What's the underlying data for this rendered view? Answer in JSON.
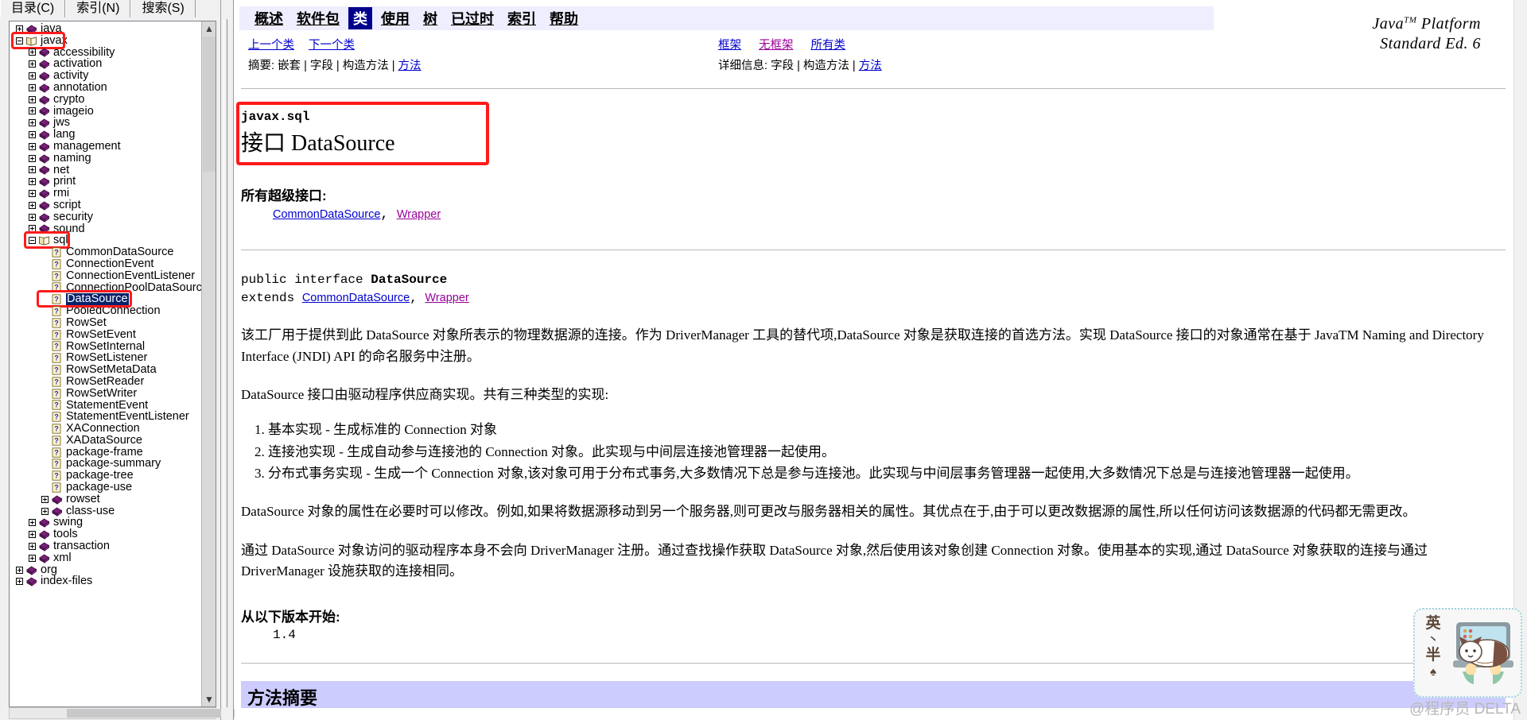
{
  "left_pane": {
    "tabs": [
      {
        "label": "目录(C)",
        "active": true
      },
      {
        "label": "索引(N)",
        "active": false
      },
      {
        "label": "搜索(S)",
        "active": false
      }
    ],
    "tree": [
      {
        "label": "java",
        "depth": 0,
        "icon": "package-icon",
        "expander": "plus",
        "selected": false
      },
      {
        "label": "javax",
        "depth": 0,
        "icon": "openbook-icon",
        "expander": "minus",
        "selected": false,
        "highlight": true
      },
      {
        "label": "accessibility",
        "depth": 1,
        "icon": "package-icon",
        "expander": "plus",
        "selected": false
      },
      {
        "label": "activation",
        "depth": 1,
        "icon": "package-icon",
        "expander": "plus",
        "selected": false
      },
      {
        "label": "activity",
        "depth": 1,
        "icon": "package-icon",
        "expander": "plus",
        "selected": false
      },
      {
        "label": "annotation",
        "depth": 1,
        "icon": "package-icon",
        "expander": "plus",
        "selected": false
      },
      {
        "label": "crypto",
        "depth": 1,
        "icon": "package-icon",
        "expander": "plus",
        "selected": false
      },
      {
        "label": "imageio",
        "depth": 1,
        "icon": "package-icon",
        "expander": "plus",
        "selected": false
      },
      {
        "label": "jws",
        "depth": 1,
        "icon": "package-icon",
        "expander": "plus",
        "selected": false
      },
      {
        "label": "lang",
        "depth": 1,
        "icon": "package-icon",
        "expander": "plus",
        "selected": false
      },
      {
        "label": "management",
        "depth": 1,
        "icon": "package-icon",
        "expander": "plus",
        "selected": false
      },
      {
        "label": "naming",
        "depth": 1,
        "icon": "package-icon",
        "expander": "plus",
        "selected": false
      },
      {
        "label": "net",
        "depth": 1,
        "icon": "package-icon",
        "expander": "plus",
        "selected": false
      },
      {
        "label": "print",
        "depth": 1,
        "icon": "package-icon",
        "expander": "plus",
        "selected": false
      },
      {
        "label": "rmi",
        "depth": 1,
        "icon": "package-icon",
        "expander": "plus",
        "selected": false
      },
      {
        "label": "script",
        "depth": 1,
        "icon": "package-icon",
        "expander": "plus",
        "selected": false
      },
      {
        "label": "security",
        "depth": 1,
        "icon": "package-icon",
        "expander": "plus",
        "selected": false
      },
      {
        "label": "sound",
        "depth": 1,
        "icon": "package-icon",
        "expander": "plus",
        "selected": false
      },
      {
        "label": "sql",
        "depth": 1,
        "icon": "openbook-icon",
        "expander": "minus",
        "selected": false,
        "highlight": true
      },
      {
        "label": "CommonDataSource",
        "depth": 2,
        "icon": "page-icon",
        "expander": "none",
        "selected": false
      },
      {
        "label": "ConnectionEvent",
        "depth": 2,
        "icon": "page-icon",
        "expander": "none",
        "selected": false
      },
      {
        "label": "ConnectionEventListener",
        "depth": 2,
        "icon": "page-icon",
        "expander": "none",
        "selected": false
      },
      {
        "label": "ConnectionPoolDataSource",
        "depth": 2,
        "icon": "page-icon",
        "expander": "none",
        "selected": false
      },
      {
        "label": "DataSource",
        "depth": 2,
        "icon": "page-icon",
        "expander": "none",
        "selected": true,
        "highlight": true
      },
      {
        "label": "PooledConnection",
        "depth": 2,
        "icon": "page-icon",
        "expander": "none",
        "selected": false
      },
      {
        "label": "RowSet",
        "depth": 2,
        "icon": "page-icon",
        "expander": "none",
        "selected": false
      },
      {
        "label": "RowSetEvent",
        "depth": 2,
        "icon": "page-icon",
        "expander": "none",
        "selected": false
      },
      {
        "label": "RowSetInternal",
        "depth": 2,
        "icon": "page-icon",
        "expander": "none",
        "selected": false
      },
      {
        "label": "RowSetListener",
        "depth": 2,
        "icon": "page-icon",
        "expander": "none",
        "selected": false
      },
      {
        "label": "RowSetMetaData",
        "depth": 2,
        "icon": "page-icon",
        "expander": "none",
        "selected": false
      },
      {
        "label": "RowSetReader",
        "depth": 2,
        "icon": "page-icon",
        "expander": "none",
        "selected": false
      },
      {
        "label": "RowSetWriter",
        "depth": 2,
        "icon": "page-icon",
        "expander": "none",
        "selected": false
      },
      {
        "label": "StatementEvent",
        "depth": 2,
        "icon": "page-icon",
        "expander": "none",
        "selected": false
      },
      {
        "label": "StatementEventListener",
        "depth": 2,
        "icon": "page-icon",
        "expander": "none",
        "selected": false
      },
      {
        "label": "XAConnection",
        "depth": 2,
        "icon": "page-icon",
        "expander": "none",
        "selected": false
      },
      {
        "label": "XADataSource",
        "depth": 2,
        "icon": "page-icon",
        "expander": "none",
        "selected": false
      },
      {
        "label": "package-frame",
        "depth": 2,
        "icon": "page-icon",
        "expander": "none",
        "selected": false
      },
      {
        "label": "package-summary",
        "depth": 2,
        "icon": "page-icon",
        "expander": "none",
        "selected": false
      },
      {
        "label": "package-tree",
        "depth": 2,
        "icon": "page-icon",
        "expander": "none",
        "selected": false
      },
      {
        "label": "package-use",
        "depth": 2,
        "icon": "page-icon",
        "expander": "none",
        "selected": false
      },
      {
        "label": "rowset",
        "depth": 2,
        "icon": "package-icon",
        "expander": "plus",
        "selected": false
      },
      {
        "label": "class-use",
        "depth": 2,
        "icon": "package-icon",
        "expander": "plus",
        "selected": false
      },
      {
        "label": "swing",
        "depth": 1,
        "icon": "package-icon",
        "expander": "plus",
        "selected": false
      },
      {
        "label": "tools",
        "depth": 1,
        "icon": "package-icon",
        "expander": "plus",
        "selected": false
      },
      {
        "label": "transaction",
        "depth": 1,
        "icon": "package-icon",
        "expander": "plus",
        "selected": false
      },
      {
        "label": "xml",
        "depth": 1,
        "icon": "package-icon",
        "expander": "plus",
        "selected": false
      },
      {
        "label": "org",
        "depth": 0,
        "icon": "package-icon",
        "expander": "plus",
        "selected": false
      },
      {
        "label": "index-files",
        "depth": 0,
        "icon": "package-icon",
        "expander": "plus",
        "selected": false
      }
    ]
  },
  "content": {
    "navbar": [
      {
        "label": "概述",
        "current": false
      },
      {
        "label": "软件包",
        "current": false
      },
      {
        "label": "类",
        "current": true
      },
      {
        "label": "使用",
        "current": false
      },
      {
        "label": "树",
        "current": false
      },
      {
        "label": "已过时",
        "current": false
      },
      {
        "label": "索引",
        "current": false
      },
      {
        "label": "帮助",
        "current": false
      }
    ],
    "subnav_left": [
      {
        "label": "上一个类",
        "visited": false
      },
      {
        "label": "下一个类",
        "visited": false
      }
    ],
    "subnav_right": [
      {
        "label": "框架",
        "visited": false
      },
      {
        "label": "无框架",
        "visited": true
      },
      {
        "label": "所有类",
        "visited": false
      }
    ],
    "summary_left_label": "摘要:",
    "summary_left_items": [
      "嵌套",
      "字段",
      "构造方法",
      "方法"
    ],
    "summary_left_link_index": 3,
    "summary_right_label": "详细信息:",
    "summary_right_items": [
      "字段",
      "构造方法",
      "方法"
    ],
    "summary_right_link_index": 2,
    "brand_line1": "Java",
    "brand_tm": "TM",
    "brand_line1_rest": " Platform",
    "brand_line2": "Standard Ed. 6",
    "package_name": "javax.sql",
    "class_title": "接口 DataSource",
    "superinterfaces_head": "所有超级接口:",
    "superinterfaces": [
      {
        "label": "CommonDataSource",
        "visited": false
      },
      {
        "label": "Wrapper",
        "visited": true
      }
    ],
    "decl_line1_prefix": "public interface ",
    "decl_line1_name": "DataSource",
    "decl_line2_prefix": "extends ",
    "decl_extends": [
      {
        "label": "CommonDataSource",
        "visited": false
      },
      {
        "label": "Wrapper",
        "visited": true
      }
    ],
    "paragraphs": [
      "该工厂用于提供到此 DataSource 对象所表示的物理数据源的连接。作为 DriverManager 工具的替代项,DataSource 对象是获取连接的首选方法。实现 DataSource 接口的对象通常在基于 JavaTM Naming and Directory Interface (JNDI) API 的命名服务中注册。",
      "DataSource 接口由驱动程序供应商实现。共有三种类型的实现:"
    ],
    "impl_list": [
      "基本实现 - 生成标准的 Connection 对象",
      "连接池实现 - 生成自动参与连接池的 Connection 对象。此实现与中间层连接池管理器一起使用。",
      "分布式事务实现 - 生成一个 Connection 对象,该对象可用于分布式事务,大多数情况下总是参与连接池。此实现与中间层事务管理器一起使用,大多数情况下总是与连接池管理器一起使用。"
    ],
    "paragraph3": "DataSource 对象的属性在必要时可以修改。例如,如果将数据源移动到另一个服务器,则可更改与服务器相关的属性。其优点在于,由于可以更改数据源的属性,所以任何访问该数据源的代码都无需更改。",
    "paragraph4": "通过 DataSource 对象访问的驱动程序本身不会向 DriverManager 注册。通过查找操作获取 DataSource 对象,然后使用该对象创建 Connection 对象。使用基本的实现,通过 DataSource 对象获取的连接与通过 DriverManager 设施获取的连接相同。",
    "since_head": "从以下版本开始:",
    "since_value": "1.4",
    "method_summary_title": "方法摘要"
  },
  "watermark": {
    "logo_chars": "英\n•\n半\n▼",
    "credit": "@程序员 DELTA"
  },
  "colors": {
    "nav_bar_bg": "#eeeeff",
    "nav_current_bg": "#00008b",
    "link": "#0000cc",
    "link_visited": "#990099",
    "annotation_red": "#ff1a1a",
    "selection_blue": "#0a246a",
    "method_summary_bg": "#ccccff",
    "package_icon": "#7b1f7b"
  }
}
